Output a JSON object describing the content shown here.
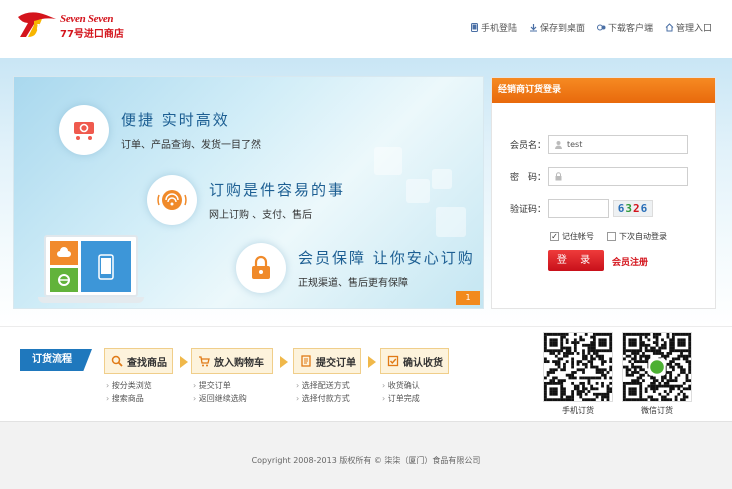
{
  "header": {
    "logo_en": "Seven Seven",
    "logo_cn": "77号进口商店",
    "links": [
      {
        "label": "手机登陆",
        "icon": "mobile-icon"
      },
      {
        "label": "保存到桌面",
        "icon": "desktop-icon"
      },
      {
        "label": "下载客户端",
        "icon": "download-icon"
      },
      {
        "label": "管理入口",
        "icon": "admin-icon"
      }
    ]
  },
  "banner": {
    "features": [
      {
        "title": "便捷 实时高效",
        "desc": "订单、产品查询、发货一目了然",
        "icon": "cart-icon"
      },
      {
        "title": "订购是件容易的事",
        "desc": "网上订购 、支付、售后",
        "icon": "wifi-icon"
      },
      {
        "title": "会员保障 让你安心订购",
        "desc": "正规渠道、售后更有保障",
        "icon": "lock-icon"
      }
    ],
    "page_indicator": "1"
  },
  "login": {
    "header": "经销商订货登录",
    "username_label": "会员名：",
    "username_value": "test",
    "password_label": "密　码：",
    "captcha_label": "验证码：",
    "captcha_chars": [
      "6",
      "3",
      "2",
      "6"
    ],
    "captcha_colors": [
      "#2a6fb8",
      "#2f9a3a",
      "#d4141c",
      "#2a6fb8"
    ],
    "remember_label": "记住帐号",
    "remember_checked": true,
    "auto_login_label": "下次自动登录",
    "auto_login_checked": false,
    "login_button": "登 录",
    "register_link": "会员注册"
  },
  "process": {
    "label": "订货流程",
    "steps": [
      {
        "title": "查找商品",
        "items": [
          "按分类浏览",
          "搜索商品"
        ],
        "icon": "search-icon"
      },
      {
        "title": "放入购物车",
        "items": [
          "提交订单",
          "返回继续选购"
        ],
        "icon": "cart-icon"
      },
      {
        "title": "提交订单",
        "items": [
          "选择配送方式",
          "选择付款方式"
        ],
        "icon": "document-icon"
      },
      {
        "title": "确认收货",
        "items": [
          "收货确认",
          "订单完成"
        ],
        "icon": "checklist-icon"
      }
    ],
    "qr_codes": [
      {
        "label": "手机订货"
      },
      {
        "label": "微信订货"
      }
    ]
  },
  "footer": {
    "copyright": "Copyright 2008-2013 版权所有 © 柒柒（厦门）食品有限公司"
  },
  "colors": {
    "brand_red": "#d4141c",
    "accent_orange": "#f07c1a",
    "process_blue": "#1f78bd"
  }
}
